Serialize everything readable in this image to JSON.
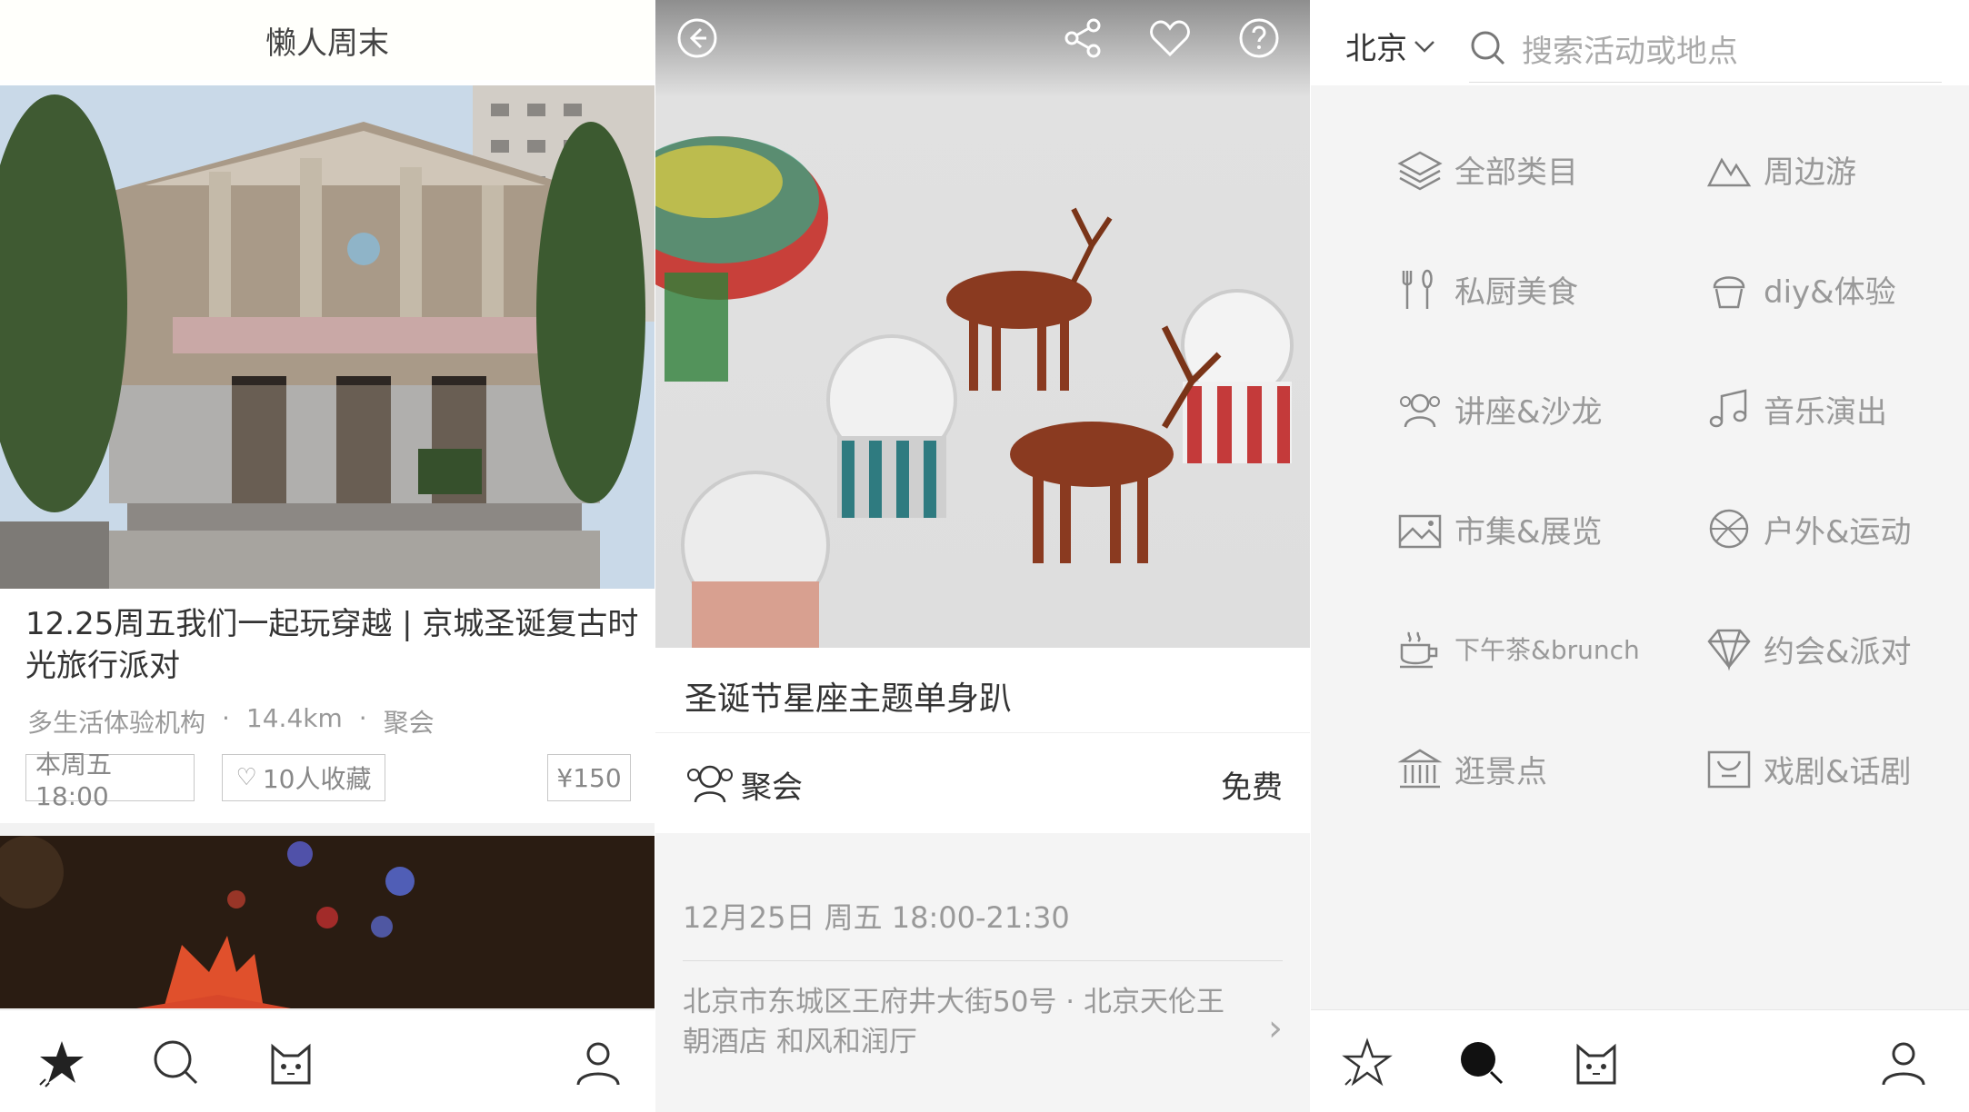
{
  "panel1": {
    "header_title": "懒人周末",
    "event": {
      "title": "12.25周五我们一起玩穿越 | 京城圣诞复古时光旅行派对",
      "organizer": "多生活体验机构",
      "distance": "14.4km",
      "category": "聚会",
      "time_badge": "本周五 18:00",
      "saved_badge": "10人收藏",
      "price_badge": "¥150"
    }
  },
  "panel2": {
    "event_title": "圣诞节星座主题单身趴",
    "category": "聚会",
    "price": "免费",
    "datetime": "12月25日 周五 18:00-21:30",
    "address": "北京市东城区王府井大街50号 · 北京天伦王朝酒店 和风和润厅"
  },
  "panel3": {
    "city": "北京",
    "search_placeholder": "搜索活动或地点",
    "categories": [
      {
        "label": "全部类目",
        "icon": "layers-icon"
      },
      {
        "label": "周边游",
        "icon": "mountain-icon"
      },
      {
        "label": "私厨美食",
        "icon": "fork-spoon-icon"
      },
      {
        "label": "diy&体验",
        "icon": "cupcake-icon"
      },
      {
        "label": "讲座&沙龙",
        "icon": "people-icon"
      },
      {
        "label": "音乐演出",
        "icon": "music-note-icon"
      },
      {
        "label": "市集&展览",
        "icon": "picture-icon"
      },
      {
        "label": "户外&运动",
        "icon": "ball-icon"
      },
      {
        "label": "下午茶&brunch",
        "icon": "teacup-icon"
      },
      {
        "label": "约会&派对",
        "icon": "diamond-icon"
      },
      {
        "label": "逛景点",
        "icon": "building-icon"
      },
      {
        "label": "戏剧&话剧",
        "icon": "theater-icon"
      }
    ]
  },
  "colors": {
    "text_dark": "#333333",
    "text_gray": "#999999",
    "background_gray": "#f4f4f4"
  }
}
